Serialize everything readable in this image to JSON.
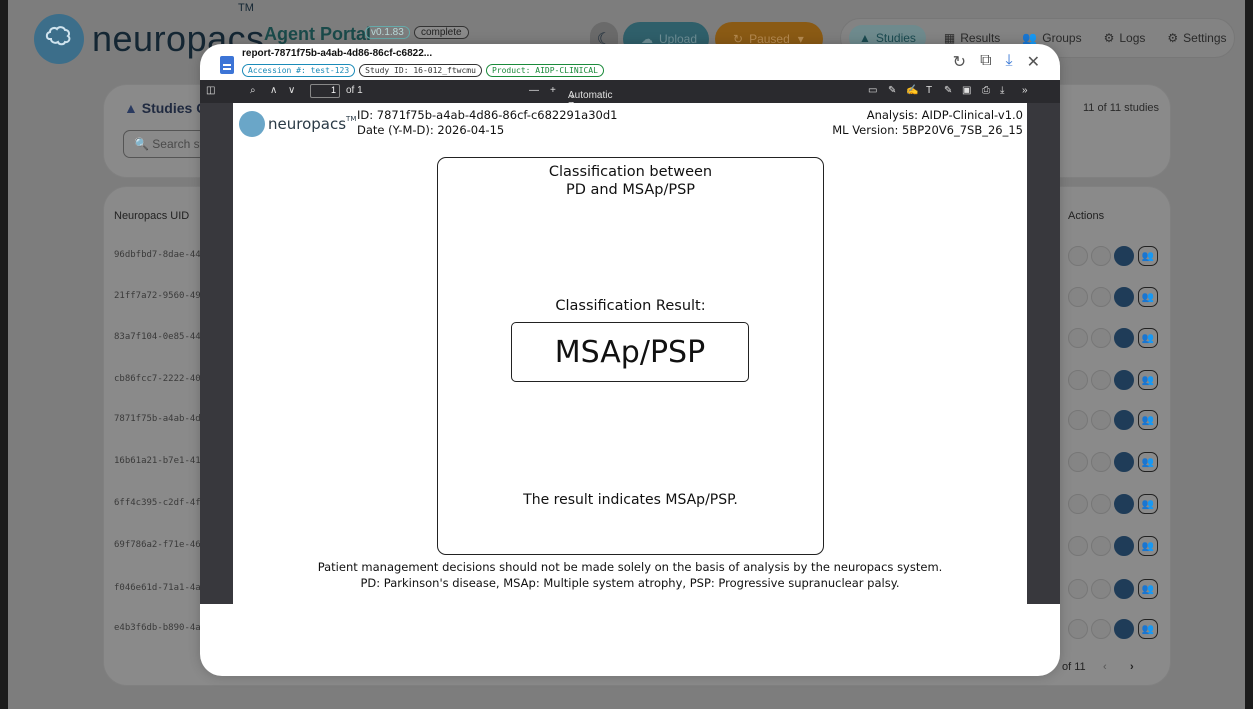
{
  "brand": {
    "logo_text": "neuropacs",
    "tm": "TM"
  },
  "portal": {
    "title": "Agent Portal",
    "version": "v0.1.83",
    "status": "complete"
  },
  "toolbar": {
    "upload_label": "Upload",
    "paused_label": "Paused"
  },
  "nav": {
    "studies": "Studies",
    "results": "Results",
    "groups": "Groups",
    "logs": "Logs",
    "settings": "Settings"
  },
  "studies_panel": {
    "title": "Studies C",
    "search_placeholder": "Search st",
    "count": "11 of 11 studies",
    "col_uid": "Neuropacs UID",
    "col_actions": "Actions",
    "uids": [
      "96dbfbd7-8dae-44",
      "21ff7a72-9560-49",
      "83a7f104-0e85-44",
      "cb86fcc7-2222-40",
      "7871f75b-a4ab-4d",
      "16b61a21-b7e1-41",
      "6ff4c395-c2df-4f",
      "69f786a2-f71e-46",
      "f046e61d-71a1-4a",
      "e4b3f6db-b890-4a"
    ],
    "pager": "of 11"
  },
  "modal": {
    "title": "report-7871f75b-a4ab-4d86-86cf-c6822...",
    "chips": {
      "accession": "Accession #: test-123",
      "study": "Study ID: 16-012_ftwcmu",
      "product": "Product: AIDP-CLINICAL"
    }
  },
  "viewer": {
    "page": "1",
    "of": "of 1",
    "zoom": "Automatic Zoom"
  },
  "report": {
    "logo_text": "neuropacs",
    "id_line": "ID: 7871f75b-a4ab-4d86-86cf-c682291a30d1",
    "date_line": "Date (Y-M-D): 2026-04-15",
    "analysis_line": "Analysis: AIDP-Clinical-v1.0",
    "ml_version_line": "ML Version: 5BP20V6_7SB_26_15",
    "classification_title_1": "Classification between",
    "classification_title_2": "PD and MSAp/PSP",
    "result_label": "Classification Result:",
    "result_value": "MSAp/PSP",
    "result_note": "The result indicates MSAp/PSP.",
    "disclaimer": "Patient management decisions should not be made solely on the basis of analysis by the neuropacs system.",
    "abbreviations": "PD: Parkinson's disease, MSAp: Multiple system atrophy, PSP: Progressive supranuclear palsy."
  }
}
